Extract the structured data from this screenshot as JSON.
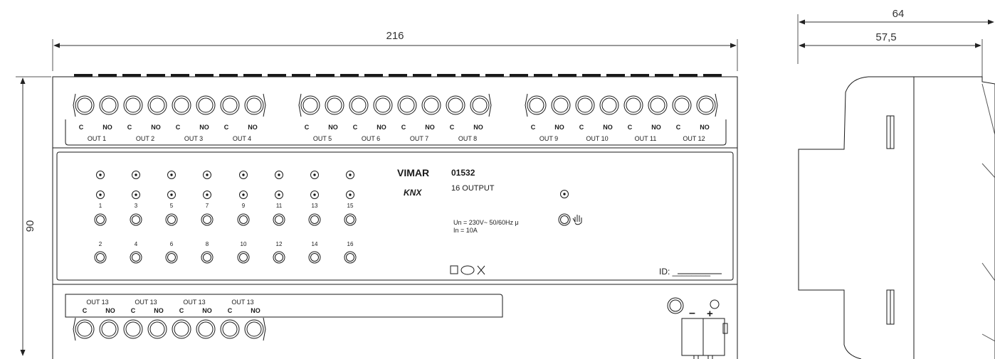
{
  "dimensions": {
    "width": "216",
    "height": "90",
    "depth_total": "64",
    "depth_body": "57,5"
  },
  "device": {
    "brand": "VIMAR",
    "knx_logo": "KNX",
    "model": "01532",
    "description": "16 OUTPUT",
    "spec_voltage": "Un = 230V~ 50/60Hz μ",
    "spec_current": "In = 10A",
    "id_label": "ID: ________",
    "symbols": "S TP X",
    "manual_icon": "hand-icon",
    "power_minus": "–",
    "power_plus": "+"
  },
  "contact_labels": {
    "c": "C",
    "no": "NO"
  },
  "top_outputs": [
    "OUT 1",
    "OUT 2",
    "OUT 3",
    "OUT 4",
    "OUT 5",
    "OUT 6",
    "OUT 7",
    "OUT 8",
    "OUT 9",
    "OUT 10",
    "OUT 11",
    "OUT 12"
  ],
  "bottom_outputs": [
    "OUT 13",
    "OUT 13",
    "OUT 13",
    "OUT 13"
  ],
  "channel_numbers_top": [
    "1",
    "3",
    "5",
    "7",
    "9",
    "11",
    "13",
    "15"
  ],
  "channel_numbers_bottom": [
    "2",
    "4",
    "6",
    "8",
    "10",
    "12",
    "14",
    "16"
  ],
  "colors": {
    "line": "#1a1a1a",
    "dim_line": "#444444",
    "background": "#ffffff"
  }
}
